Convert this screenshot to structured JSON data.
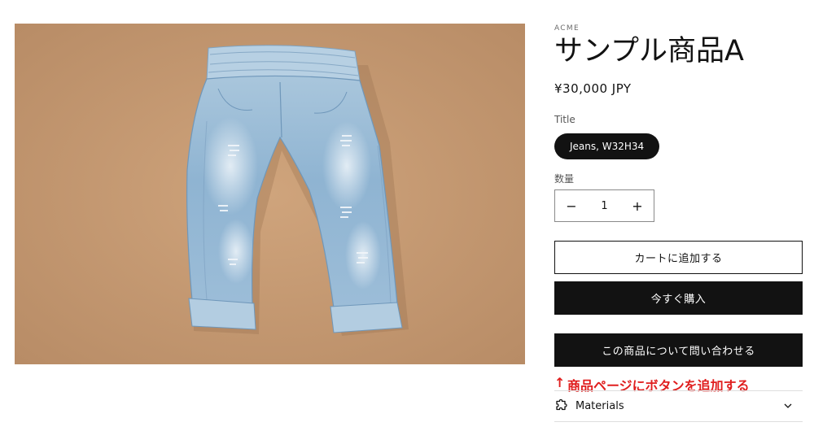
{
  "product": {
    "vendor": "ACME",
    "title": "サンプル商品A",
    "price": "¥30,000 JPY",
    "image_icon": "jeans-photo"
  },
  "variant": {
    "label": "Title",
    "selected": "Jeans, W32H34"
  },
  "quantity": {
    "label": "数量",
    "value": "1",
    "decrease": "−",
    "increase": "+"
  },
  "buttons": {
    "add_to_cart": "カートに追加する",
    "buy_now": "今すぐ購入",
    "inquire": "この商品について問い合わせる"
  },
  "annotation": {
    "arrow": "↑",
    "text": "商品ページにボタンを追加する",
    "color": "#e01e1e"
  },
  "accordion": {
    "label": "Materials",
    "icon": "puzzle-icon",
    "chevron": "chevron-down-icon"
  },
  "colors": {
    "dark": "#121212",
    "photo_background": "#c49a74"
  }
}
